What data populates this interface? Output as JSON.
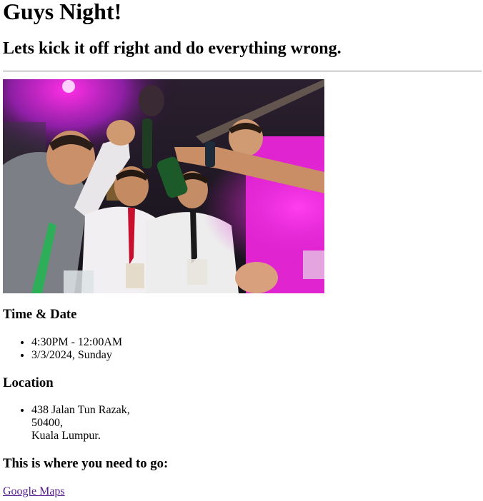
{
  "header": {
    "title": "Guys Night!",
    "subtitle": "Lets kick it off right and do everything wrong."
  },
  "photo": {
    "description_icon": "party-photo"
  },
  "time_date": {
    "heading": "Time & Date",
    "items": [
      "4:30PM - 12:00AM",
      "3/3/2024, Sunday"
    ]
  },
  "location": {
    "heading": "Location",
    "address_lines": [
      "438 Jalan Tun Razak,",
      "50400,",
      "Kuala Lumpur."
    ]
  },
  "directions": {
    "heading": "This is where you need to go:",
    "link_label": "Google Maps"
  },
  "colors": {
    "visited_link": "#551a8b",
    "rule": "#9a9a9a"
  }
}
